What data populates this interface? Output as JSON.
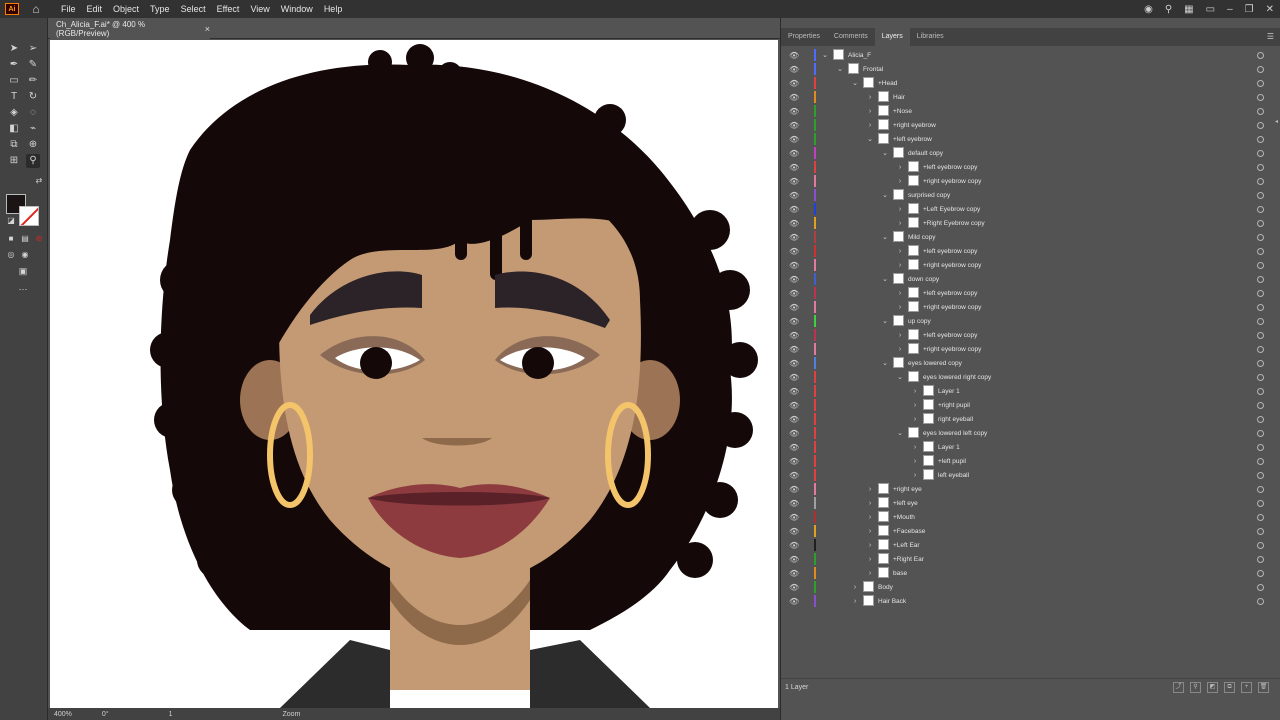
{
  "app": {
    "logo_text": "Ai"
  },
  "menu": [
    "File",
    "Edit",
    "Object",
    "Type",
    "Select",
    "Effect",
    "View",
    "Window",
    "Help"
  ],
  "document": {
    "tab_title": "Ch_Alicia_F.ai* @ 400 % (RGB/Preview)",
    "close": "×"
  },
  "status": {
    "zoom": "400%",
    "rotation": "0°",
    "artboard": "1",
    "tool_label": "Zoom"
  },
  "panel": {
    "tabs": [
      "Properties",
      "Comments",
      "Layers",
      "Libraries"
    ],
    "active_tab": "Layers",
    "footer_count": "1 Layer",
    "layers": [
      {
        "name": "Alicia_F",
        "depth": 0,
        "expanded": true,
        "color": "#4f6bff"
      },
      {
        "name": "Frontal",
        "depth": 1,
        "expanded": true,
        "color": "#4f6bff"
      },
      {
        "name": "+Head",
        "depth": 2,
        "expanded": true,
        "color": "#e04040"
      },
      {
        "name": "Hair",
        "depth": 3,
        "expanded": false,
        "color": "#e08a20"
      },
      {
        "name": "+Nose",
        "depth": 3,
        "expanded": false,
        "color": "#2ca02c"
      },
      {
        "name": "+right eyebrow",
        "depth": 3,
        "expanded": false,
        "color": "#2ca02c"
      },
      {
        "name": "+left eyebrow",
        "depth": 3,
        "expanded": true,
        "color": "#2ca02c"
      },
      {
        "name": "default copy",
        "depth": 4,
        "expanded": true,
        "color": "#c040c0"
      },
      {
        "name": "+left eyebrow copy",
        "depth": 5,
        "expanded": false,
        "color": "#e04040"
      },
      {
        "name": "+right eyebrow copy",
        "depth": 5,
        "expanded": false,
        "color": "#e07aa0"
      },
      {
        "name": "surprised copy",
        "depth": 4,
        "expanded": true,
        "color": "#8a4fd0"
      },
      {
        "name": "+Left Eyebrow copy",
        "depth": 5,
        "expanded": false,
        "color": "#2040e0"
      },
      {
        "name": "+Right Eyebrow copy",
        "depth": 5,
        "expanded": false,
        "color": "#e0a020"
      },
      {
        "name": "Mild copy",
        "depth": 4,
        "expanded": true,
        "color": "#b04040"
      },
      {
        "name": "+left eyebrow copy",
        "depth": 5,
        "expanded": false,
        "color": "#d03030"
      },
      {
        "name": "+right eyebrow copy",
        "depth": 5,
        "expanded": false,
        "color": "#e07aa0"
      },
      {
        "name": "down copy",
        "depth": 4,
        "expanded": true,
        "color": "#4060d0"
      },
      {
        "name": "+left eyebrow copy",
        "depth": 5,
        "expanded": false,
        "color": "#c03050"
      },
      {
        "name": "+right eyebrow copy",
        "depth": 5,
        "expanded": false,
        "color": "#e07aa0"
      },
      {
        "name": "up copy",
        "depth": 4,
        "expanded": true,
        "color": "#40d040"
      },
      {
        "name": "+left eyebrow copy",
        "depth": 5,
        "expanded": false,
        "color": "#c03050"
      },
      {
        "name": "+right eyebrow copy",
        "depth": 5,
        "expanded": false,
        "color": "#e07aa0"
      },
      {
        "name": "eyes lowered copy",
        "depth": 4,
        "expanded": true,
        "color": "#5080e0"
      },
      {
        "name": "eyes lowered right copy",
        "depth": 5,
        "expanded": true,
        "color": "#e04040"
      },
      {
        "name": "Layer 1",
        "depth": 6,
        "expanded": false,
        "color": "#e04040"
      },
      {
        "name": "+right pupil",
        "depth": 6,
        "expanded": false,
        "color": "#e04040"
      },
      {
        "name": "right eyeball",
        "depth": 6,
        "expanded": false,
        "color": "#e04040"
      },
      {
        "name": "eyes lowered left copy",
        "depth": 5,
        "expanded": true,
        "color": "#e04040"
      },
      {
        "name": "Layer 1",
        "depth": 6,
        "expanded": false,
        "color": "#e04040"
      },
      {
        "name": "+left pupil",
        "depth": 6,
        "expanded": false,
        "color": "#e04040"
      },
      {
        "name": "left eyeball",
        "depth": 6,
        "expanded": false,
        "color": "#e04040"
      },
      {
        "name": "+right eye",
        "depth": 3,
        "expanded": false,
        "color": "#e07aa0"
      },
      {
        "name": "+left eye",
        "depth": 3,
        "expanded": false,
        "color": "#a0a0a0"
      },
      {
        "name": "+Mouth",
        "depth": 3,
        "expanded": false,
        "color": "#b03030"
      },
      {
        "name": "+Facebase",
        "depth": 3,
        "expanded": false,
        "color": "#e0a020"
      },
      {
        "name": "+Left Ear",
        "depth": 3,
        "expanded": false,
        "color": "#202020"
      },
      {
        "name": "+Right Ear",
        "depth": 3,
        "expanded": false,
        "color": "#2ca02c"
      },
      {
        "name": "base",
        "depth": 3,
        "expanded": false,
        "color": "#e08a20"
      },
      {
        "name": "Body",
        "depth": 2,
        "expanded": false,
        "color": "#2ca02c"
      },
      {
        "name": "Hair Back",
        "depth": 2,
        "expanded": false,
        "color": "#8a4fd0"
      }
    ]
  }
}
